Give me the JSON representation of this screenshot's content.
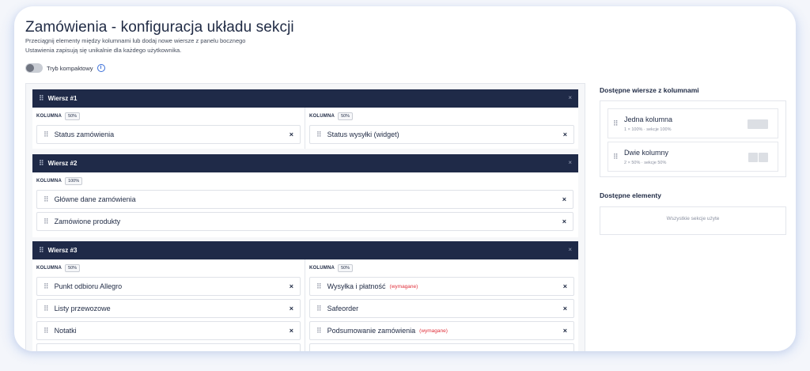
{
  "page": {
    "title": "Zamówienia - konfiguracja układu sekcji",
    "subtitle_line1": "Przeciągnij elementy między kolumnami lub dodaj nowe wiersze z panelu bocznego",
    "subtitle_line2": "Ustawienia zapisują się unikalnie dla każdego użytkownika.",
    "compact_toggle_label": "Tryb kompaktowy",
    "compact_toggle_on": false,
    "info_glyph": "i"
  },
  "labels": {
    "column": "KOLUMNA",
    "remove_glyph": "×",
    "required": "(wymagane)"
  },
  "rows": [
    {
      "title": "Wiersz #1",
      "columns": [
        {
          "width": "50%",
          "items": [
            {
              "label": "Status zamówienia",
              "required": false
            }
          ]
        },
        {
          "width": "50%",
          "items": [
            {
              "label": "Status wysyłki (widget)",
              "required": false
            }
          ]
        }
      ]
    },
    {
      "title": "Wiersz #2",
      "columns": [
        {
          "width": "100%",
          "items": [
            {
              "label": "Główne dane zamówienia",
              "required": false
            },
            {
              "label": "Zamówione produkty",
              "required": false
            }
          ]
        }
      ]
    },
    {
      "title": "Wiersz #3",
      "columns": [
        {
          "width": "50%",
          "items": [
            {
              "label": "Punkt odbioru Allegro",
              "required": false
            },
            {
              "label": "Listy przewozowe",
              "required": false
            },
            {
              "label": "Notatki",
              "required": false
            }
          ]
        },
        {
          "width": "50%",
          "items": [
            {
              "label": "Wysyłka i płatność",
              "required": true
            },
            {
              "label": "Safeorder",
              "required": false
            },
            {
              "label": "Podsumowanie zamówienia",
              "required": true
            }
          ]
        }
      ]
    }
  ],
  "sidebar": {
    "row_templates_title": "Dostępne wiersze z kolumnami",
    "row_templates": [
      {
        "name": "Jedna kolumna",
        "desc": "1 × 100% · sekcje 100%"
      },
      {
        "name": "Dwie kolumny",
        "desc": "2 × 50% · sekcje 50%"
      }
    ],
    "elements_title": "Dostępne elementy",
    "elements_empty": "Wszystkie sekcje użyte"
  },
  "colors": {
    "row_header_bg": "#1f2a48",
    "required_text": "#e02f3a",
    "info_accent": "#3b6fd8"
  }
}
